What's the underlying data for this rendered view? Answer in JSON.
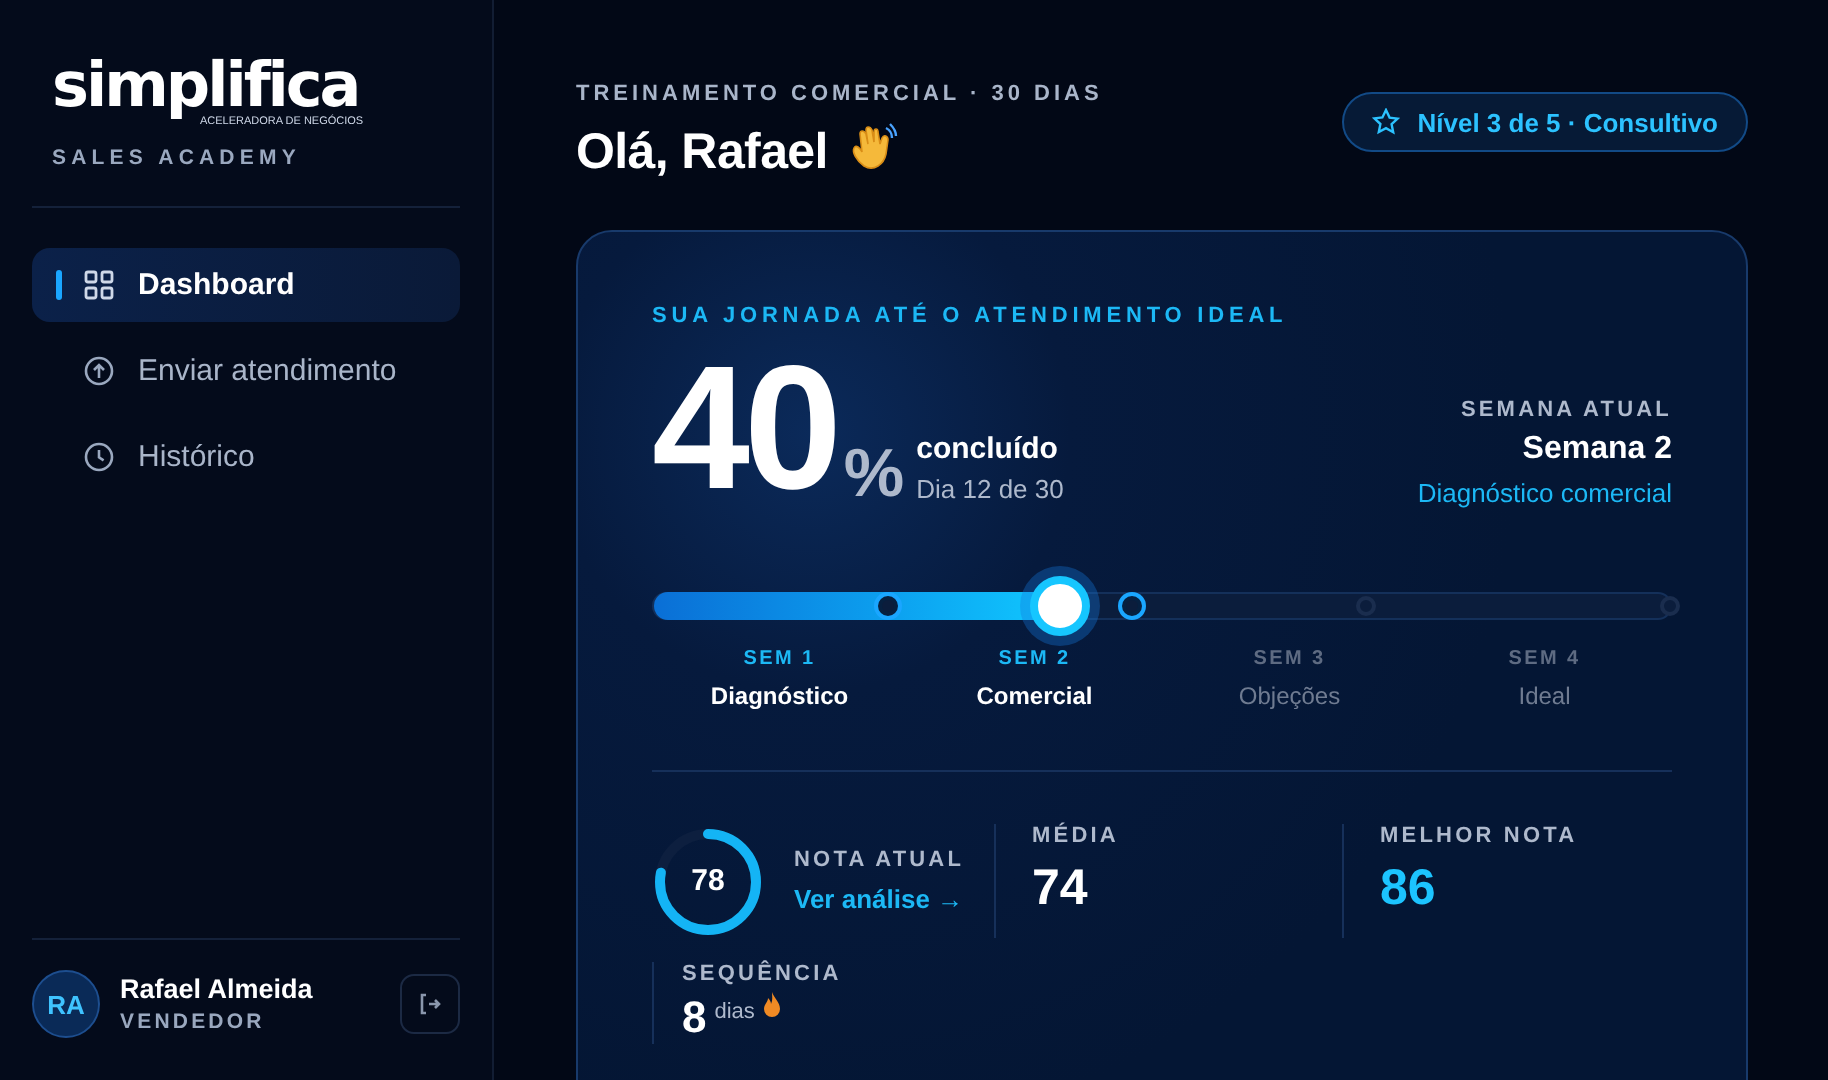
{
  "sidebar": {
    "logo": "simplifica",
    "logo_tagline": "ACELERADORA DE NEGÓCIOS",
    "subtitle": "SALES ACADEMY",
    "items": [
      {
        "label": "Dashboard",
        "kind": "grid",
        "selected": true
      },
      {
        "label": "Enviar atendimento",
        "kind": "upload",
        "selected": false
      },
      {
        "label": "Histórico",
        "kind": "clock",
        "selected": false
      }
    ],
    "user": {
      "initials": "RA",
      "name": "Rafael Almeida",
      "role": "VENDEDOR"
    }
  },
  "header": {
    "eyebrow": "TREINAMENTO COMERCIAL · 30 DIAS",
    "greeting": "Olá, Rafael",
    "badge": "Nível 3 de 5 · Consultivo"
  },
  "journey": {
    "title": "SUA JORNADA ATÉ O ATENDIMENTO IDEAL",
    "percent": "40",
    "percent_sign": "%",
    "status": "concluído",
    "day": "Dia 12 de 30",
    "week_label": "SEMANA ATUAL",
    "week": "Semana 2",
    "week_topic": "Diagnóstico comercial",
    "level": 0.4,
    "weeks": [
      {
        "code": "SEM 1",
        "name": "Diagnóstico",
        "reached": true
      },
      {
        "code": "SEM 2",
        "name": "Comercial",
        "reached": true
      },
      {
        "code": "SEM 3",
        "name": "Objeções",
        "reached": false
      },
      {
        "code": "SEM 4",
        "name": "Ideal",
        "reached": false
      }
    ],
    "score": {
      "value": "78",
      "label": "NOTA ATUAL",
      "link": "Ver análise →"
    },
    "stats": [
      {
        "label": "MÉDIA",
        "value": "74",
        "highlight": false
      },
      {
        "label": "MELHOR NOTA",
        "value": "86",
        "highlight": true
      }
    ],
    "streak": {
      "label": "SEQUÊNCIA",
      "value": "8",
      "unit": "dias"
    }
  }
}
